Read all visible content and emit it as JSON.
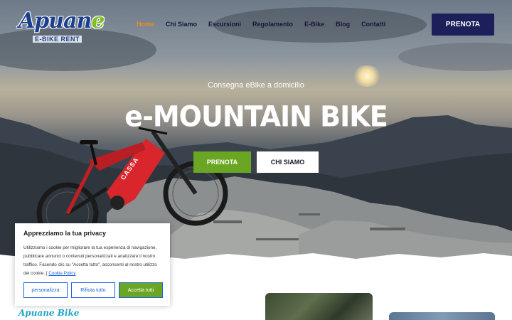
{
  "logo": {
    "brand_main": "Apuan",
    "brand_e": "e",
    "sub": "E-BIKE RENT"
  },
  "nav": [
    {
      "label": "Home",
      "active": true
    },
    {
      "label": "Chi Siamo"
    },
    {
      "label": "Escursioni"
    },
    {
      "label": "Regolamento"
    },
    {
      "label": "E-Bike"
    },
    {
      "label": "Blog"
    },
    {
      "label": "Contatti"
    }
  ],
  "header_button": "PRENOTA",
  "hero": {
    "tagline": "Consegna eBike a domicilio",
    "headline": "e-MOUNTAIN BIKE",
    "bike_brand": "CASSA",
    "primary_button": "PRENOTA",
    "secondary_button": "CHI SIAMO"
  },
  "cookie": {
    "title": "Apprezziamo la tua privacy",
    "text": "Utilizziamo i cookie per migliorare la tua esperienza di navigazione, pubblicare annunci o contenuti personalizzati e analizzare il nostro traffico. Facendo clic su \"Accetta tutto\", acconsenti al nostro utilizzo dei cookie. [",
    "policy_link": "Cookie Policy",
    "buttons": {
      "customize": "personalizza",
      "reject": "Rifiuta tutto",
      "accept": "Accetta tutti"
    }
  },
  "section": {
    "title": "Apuane Bike"
  },
  "colors": {
    "nav_active": "#f08c1a",
    "primary_dark": "#1c1f5a",
    "green": "#6aa623",
    "link_blue": "#1863dc"
  }
}
